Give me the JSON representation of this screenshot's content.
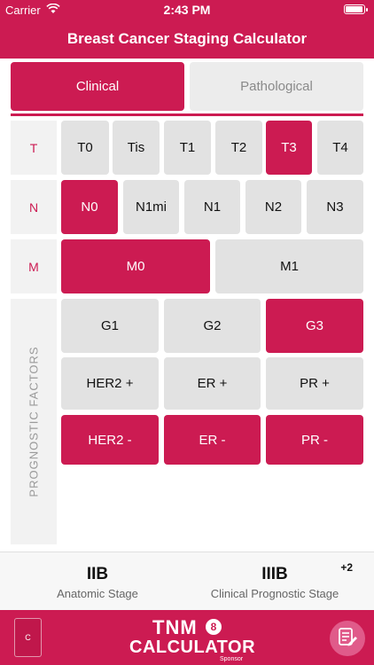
{
  "status_bar": {
    "carrier": "Carrier",
    "time": "2:43 PM"
  },
  "nav": {
    "title": "Breast Cancer Staging Calculator"
  },
  "mode_tabs": {
    "clinical": "Clinical",
    "pathological": "Pathological",
    "selected": "Clinical"
  },
  "rows": {
    "t_label": "T",
    "n_label": "N",
    "m_label": "M",
    "prognostic_label": "PROGNOSTIC FACTORS"
  },
  "t_options": {
    "t0": "T0",
    "tis": "Tis",
    "t1": "T1",
    "t2": "T2",
    "t3": "T3",
    "t4": "T4",
    "selected": "T3"
  },
  "n_options": {
    "n0": "N0",
    "n1mi": "N1mi",
    "n1": "N1",
    "n2": "N2",
    "n3": "N3",
    "selected": "N0"
  },
  "m_options": {
    "m0": "M0",
    "m1": "M1",
    "selected": "M0"
  },
  "grade_options": {
    "g1": "G1",
    "g2": "G2",
    "g3": "G3",
    "selected": "G3"
  },
  "receptor_positive": {
    "her2": "HER2 +",
    "er": "ER +",
    "pr": "PR +"
  },
  "receptor_negative": {
    "her2": "HER2 -",
    "er": "ER -",
    "pr": "PR -"
  },
  "results": {
    "anatomic_stage": "IIB",
    "anatomic_label": "Anatomic Stage",
    "prognostic_stage": "IIIB",
    "prognostic_label": "Clinical Prognostic Stage",
    "prognostic_delta": "+2"
  },
  "bottom": {
    "sponsor_box": "C",
    "logo_tnm": "TNM",
    "logo_edition": "8",
    "logo_calc": "CALCULATOR",
    "logo_sponsor": "Sponsor"
  },
  "colors": {
    "accent": "#cc1b52",
    "cell": "#e2e2e2",
    "label_bg": "#f2f2f2"
  },
  "icons": {
    "wifi": "wifi-icon",
    "battery": "battery-icon",
    "notes": "notes-edit-icon"
  }
}
